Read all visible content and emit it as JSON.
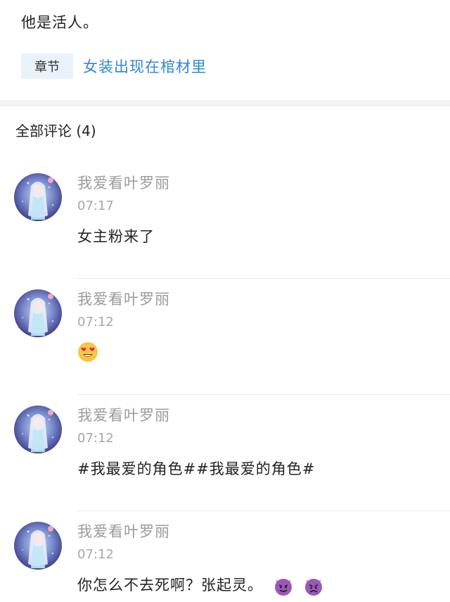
{
  "post": {
    "text": "他是活人。"
  },
  "chapter": {
    "tag": "章节",
    "link": "女装出现在棺材里"
  },
  "comments_header": "全部评论 (4)",
  "comments": [
    {
      "username": "我爱看叶罗丽",
      "time": "07:17",
      "content": "女主粉来了"
    },
    {
      "username": "我爱看叶罗丽",
      "time": "07:12",
      "content": "",
      "emoji": "heart-eyes-emoji"
    },
    {
      "username": "我爱看叶罗丽",
      "time": "07:12",
      "content": "#我最爱的角色##我最爱的角色#"
    },
    {
      "username": "我爱看叶罗丽",
      "time": "07:12",
      "content": "你怎么不去死啊？张起灵。",
      "emoji": "devil-emojis"
    }
  ],
  "colors": {
    "link": "#2f87d9",
    "tag_bg": "#eaf2f9",
    "meta_text": "#9b9b9b",
    "divider": "#f2f3f5"
  }
}
